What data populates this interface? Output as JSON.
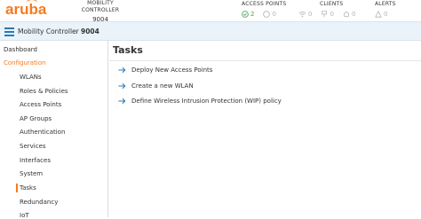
{
  "brand": {
    "logo_text": "aruba",
    "color": "#f47b20"
  },
  "controller": {
    "title": "MOBILITY CONTROLLER",
    "id": "9004"
  },
  "header": {
    "access_points": {
      "title": "ACCESS POINTS",
      "up": "2",
      "down": "0"
    },
    "clients": {
      "title": "CLIENTS",
      "wireless": "0",
      "wired": "0",
      "remote": "0"
    },
    "alerts": {
      "title": "ALERTS",
      "count": "0"
    }
  },
  "breadcrumb": {
    "root": "Mobility Controller",
    "separator": "›",
    "current": "9004"
  },
  "sidebar": {
    "dashboard": "Dashboard",
    "configuration": "Configuration",
    "items": [
      {
        "label": "WLANs"
      },
      {
        "label": "Roles & Policies"
      },
      {
        "label": "Access Points"
      },
      {
        "label": "AP Groups"
      },
      {
        "label": "Authentication"
      },
      {
        "label": "Services"
      },
      {
        "label": "Interfaces"
      },
      {
        "label": "System"
      },
      {
        "label": "Tasks"
      },
      {
        "label": "Redundancy"
      },
      {
        "label": "IoT"
      }
    ],
    "active": "Tasks"
  },
  "main": {
    "title": "Tasks",
    "tasks": [
      {
        "label": "Deploy New Access Points"
      },
      {
        "label": "Create a new WLAN"
      },
      {
        "label": "Define Wireless Intrusion Protection (WIP) policy"
      }
    ]
  },
  "colors": {
    "accent": "#f47b20",
    "link_arrow": "#2a7ab5",
    "ok": "#4aa44a",
    "breadcrumb_bg": "#eaf3f9"
  }
}
